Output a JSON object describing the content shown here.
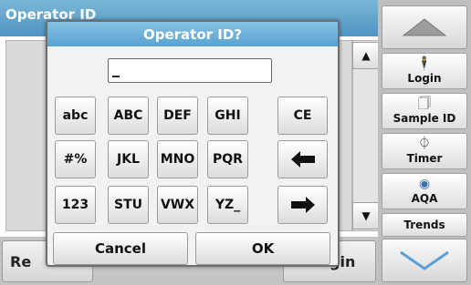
{
  "background": {
    "header_title": "Operator ID",
    "bottom_left_label": "Re",
    "bottom_right_label": "gin"
  },
  "sidebar": {
    "up_icon": "triangle-up-icon",
    "down_icon": "chevron-down-icon",
    "items": [
      {
        "label": "Login",
        "icon": "person-icon",
        "glyph": "🕴"
      },
      {
        "label": "Sample ID",
        "icon": "beaker-icon",
        "glyph": "🗍"
      },
      {
        "label": "Timer",
        "icon": "timer-icon",
        "glyph": "⏀"
      },
      {
        "label": "AQA",
        "icon": "aqa-icon",
        "glyph": "◉"
      },
      {
        "label": "Trends",
        "icon": "trends-icon",
        "glyph": "〰"
      }
    ]
  },
  "dialog": {
    "title": "Operator ID?",
    "input_value": "",
    "keys": {
      "row1": [
        "abc",
        "ABC",
        "DEF",
        "GHI",
        "CE"
      ],
      "row2": [
        "#%",
        "JKL",
        "MNO",
        "PQR",
        "←"
      ],
      "row3": [
        "123",
        "STU",
        "VWX",
        "YZ_",
        "→"
      ]
    },
    "cancel_label": "Cancel",
    "ok_label": "OK"
  },
  "colors": {
    "title_bar": "#5aa3d0",
    "sidebar_bg": "#bfbfbf",
    "nav_arrow": "#5b9fd4"
  }
}
